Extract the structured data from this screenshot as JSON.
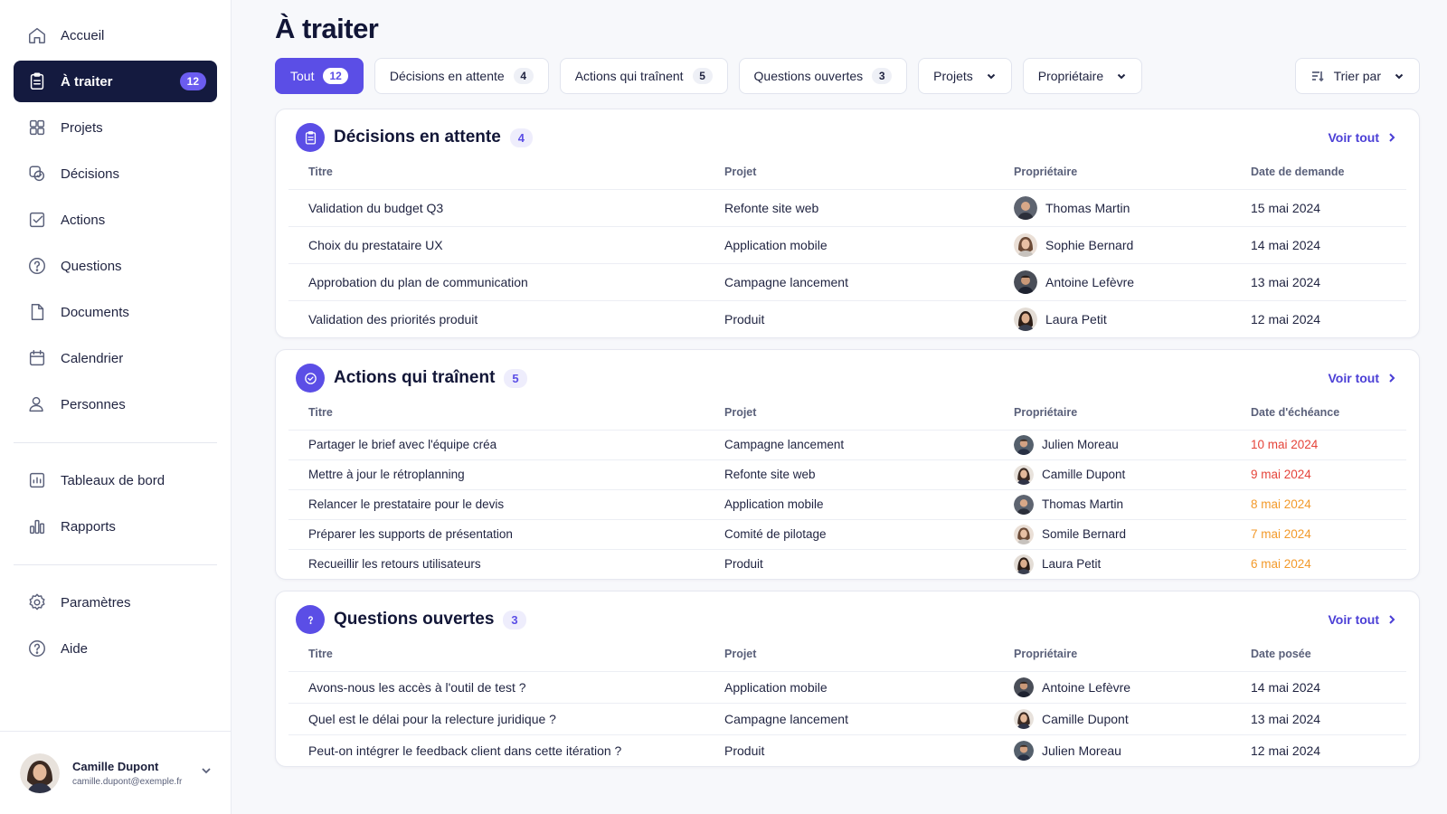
{
  "sidebar": {
    "items": [
      {
        "label": "Accueil",
        "icon": "home-icon"
      },
      {
        "label": "À traiter",
        "icon": "clipboard-icon",
        "badge": "12",
        "active": true
      },
      {
        "label": "Projets",
        "icon": "grid-icon"
      },
      {
        "label": "Décisions",
        "icon": "decisions-icon"
      },
      {
        "label": "Actions",
        "icon": "checkbox-icon"
      },
      {
        "label": "Questions",
        "icon": "question-icon"
      },
      {
        "label": "Documents",
        "icon": "document-icon"
      },
      {
        "label": "Calendrier",
        "icon": "calendar-icon"
      },
      {
        "label": "Personnes",
        "icon": "people-icon"
      }
    ],
    "items2": [
      {
        "label": "Tableaux de bord",
        "icon": "dashboard-icon"
      },
      {
        "label": "Rapports",
        "icon": "bar-chart-icon"
      }
    ],
    "items3": [
      {
        "label": "Paramètres",
        "icon": "gear-icon"
      },
      {
        "label": "Aide",
        "icon": "help-icon"
      }
    ],
    "user": {
      "name": "Camille Dupont",
      "email": "camille.dupont@exemple.fr"
    }
  },
  "page": {
    "title": "À traiter"
  },
  "filters": {
    "all": {
      "label": "Tout",
      "count": "12"
    },
    "decisions": {
      "label": "Décisions en attente",
      "count": "4"
    },
    "actions": {
      "label": "Actions qui traînent",
      "count": "5"
    },
    "questions": {
      "label": "Questions ouvertes",
      "count": "3"
    },
    "projects": "Projets",
    "owner": "Propriétaire",
    "sort": "Trier par"
  },
  "colors": {
    "accent": "#5b4ee6",
    "nav_active": "#141a3f",
    "overdue_red": "#e5443a",
    "overdue_orange": "#f39a2b"
  },
  "decisions": {
    "title": "Décisions en attente",
    "count": "4",
    "see_all": "Voir tout",
    "headers": {
      "title": "Titre",
      "project": "Projet",
      "owner": "Propriétaire",
      "date": "Date de demande"
    },
    "rows": [
      {
        "title": "Validation du budget Q3",
        "project": "Refonte site web",
        "owner": "Thomas Martin",
        "date": "15 mai 2024"
      },
      {
        "title": "Choix du prestataire UX",
        "project": "Application mobile",
        "owner": "Sophie Bernard",
        "date": "14 mai 2024"
      },
      {
        "title": "Approbation du plan de communication",
        "project": "Campagne lancement",
        "owner": "Antoine Lefèvre",
        "date": "13 mai 2024"
      },
      {
        "title": "Validation des priorités produit",
        "project": "Produit",
        "owner": "Laura Petit",
        "date": "12 mai 2024"
      }
    ]
  },
  "actions": {
    "title": "Actions qui traînent",
    "count": "5",
    "see_all": "Voir tout",
    "headers": {
      "title": "Titre",
      "project": "Projet",
      "owner": "Propriétaire",
      "date": "Date d'échéance"
    },
    "rows": [
      {
        "title": "Partager le brief avec l'équipe créa",
        "project": "Campagne lancement",
        "owner": "Julien Moreau",
        "date": "10 mai 2024"
      },
      {
        "title": "Mettre à jour le rétroplanning",
        "project": "Refonte site web",
        "owner": "Camille Dupont",
        "date": "9 mai 2024"
      },
      {
        "title": "Relancer le prestataire pour le devis",
        "project": "Application mobile",
        "owner": "Thomas Martin",
        "date": "8 mai 2024"
      },
      {
        "title": "Préparer les supports de présentation",
        "project": "Comité de pilotage",
        "owner": "Somile Bernard",
        "date": "7 mai 2024"
      },
      {
        "title": "Recueillir les retours utilisateurs",
        "project": "Produit",
        "owner": "Laura Petit",
        "date": "6 mai 2024"
      }
    ]
  },
  "questions": {
    "title": "Questions ouvertes",
    "count": "3",
    "see_all": "Voir tout",
    "headers": {
      "title": "Titre",
      "project": "Projet",
      "owner": "Propriétaire",
      "date": "Date posée"
    },
    "rows": [
      {
        "title": "Avons-nous les accès à l'outil de test ?",
        "project": "Application mobile",
        "owner": "Antoine Lefèvre",
        "date": "14 mai 2024"
      },
      {
        "title": "Quel est le délai pour la relecture juridique ?",
        "project": "Campagne lancement",
        "owner": "Camille Dupont",
        "date": "13 mai 2024"
      },
      {
        "title": "Peut-on intégrer le feedback client dans cette itération ?",
        "project": "Produit",
        "owner": "Julien Moreau",
        "date": "12 mai 2024"
      }
    ]
  }
}
